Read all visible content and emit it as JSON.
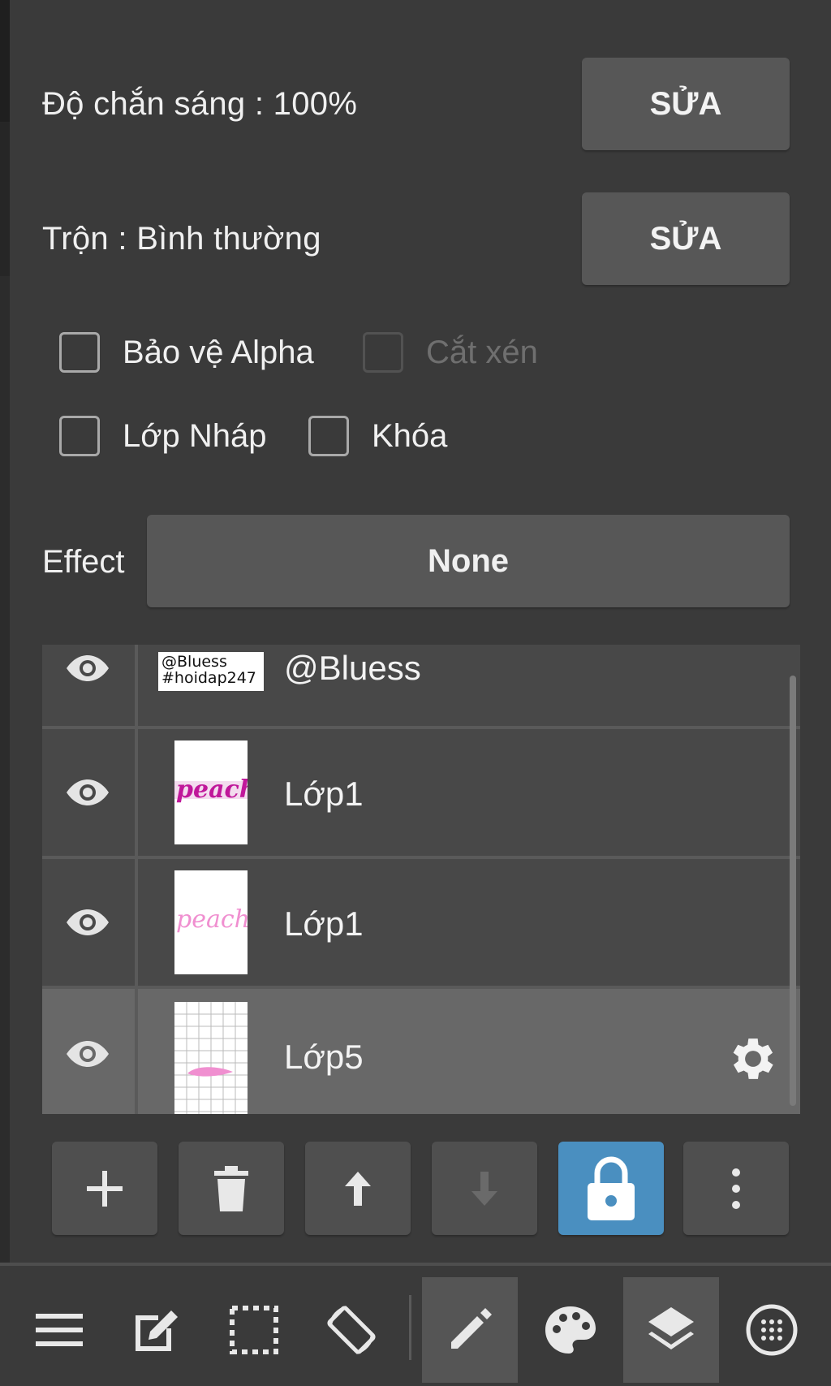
{
  "properties": {
    "opacity_label": "Độ chắn sáng : 100%",
    "opacity_edit": "SỬA",
    "blend_label": "Trộn : Bình thường",
    "blend_edit": "SỬA"
  },
  "checkboxes": {
    "protect_alpha": "Bảo vệ Alpha",
    "clipping": "Cắt xén",
    "draft_layer": "Lớp Nháp",
    "lock": "Khóa"
  },
  "effect": {
    "label": "Effect",
    "value": "None"
  },
  "layers": [
    {
      "name": "@Bluess",
      "thumb_text_1": "@Bluess",
      "thumb_text_2": "#hoidap247"
    },
    {
      "name": "Lớp1",
      "thumb_word": "peach"
    },
    {
      "name": "Lớp1",
      "thumb_word": "peach"
    },
    {
      "name": "Lớp5",
      "selected": true
    }
  ],
  "layer_toolbar": [
    "add-icon",
    "trash-icon",
    "move-up-icon",
    "move-down-icon",
    "lock-icon",
    "more-icon"
  ],
  "bottom_nav": [
    "menu-icon",
    "edit-icon",
    "selection-icon",
    "rotate-icon",
    "brush-icon",
    "palette-icon",
    "layers-icon",
    "grid-icon"
  ],
  "colors": {
    "accent": "#4a8fc0",
    "background": "#3a3a3a",
    "button": "#575757",
    "selected_layer": "#686868",
    "thumb_pink_dark": "#c0179a",
    "thumb_pink_light": "#f08fd0"
  }
}
